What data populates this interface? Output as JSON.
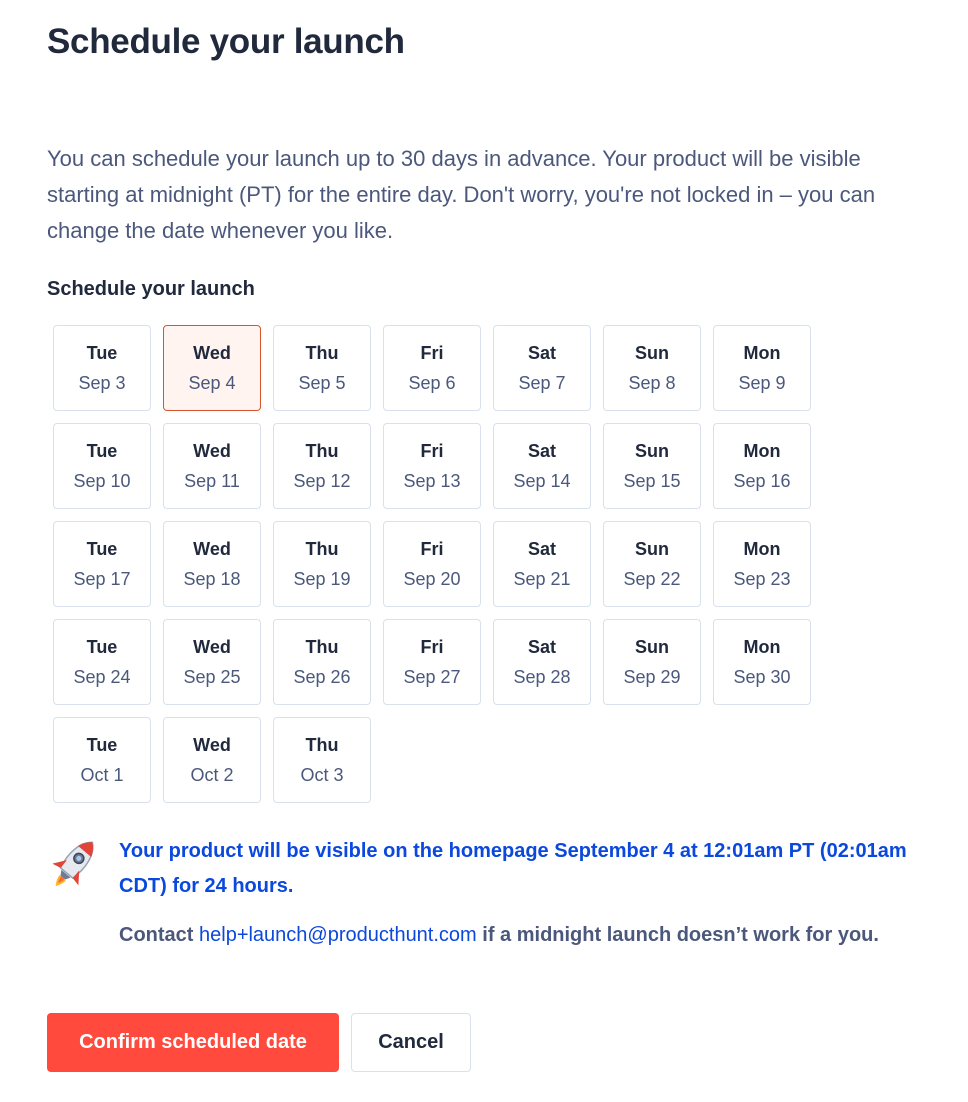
{
  "page": {
    "title": "Schedule your launch",
    "intro": "You can schedule your launch up to 30 days in advance. Your product will be visible starting at midnight (PT) for the entire day. Don't worry, you're not locked in – you can change the date whenever you like.",
    "section_label": "Schedule your launch"
  },
  "dates": [
    {
      "day": "Tue",
      "date": "Sep 3",
      "selected": false
    },
    {
      "day": "Wed",
      "date": "Sep 4",
      "selected": true
    },
    {
      "day": "Thu",
      "date": "Sep 5",
      "selected": false
    },
    {
      "day": "Fri",
      "date": "Sep 6",
      "selected": false
    },
    {
      "day": "Sat",
      "date": "Sep 7",
      "selected": false
    },
    {
      "day": "Sun",
      "date": "Sep 8",
      "selected": false
    },
    {
      "day": "Mon",
      "date": "Sep 9",
      "selected": false
    },
    {
      "day": "Tue",
      "date": "Sep 10",
      "selected": false
    },
    {
      "day": "Wed",
      "date": "Sep 11",
      "selected": false
    },
    {
      "day": "Thu",
      "date": "Sep 12",
      "selected": false
    },
    {
      "day": "Fri",
      "date": "Sep 13",
      "selected": false
    },
    {
      "day": "Sat",
      "date": "Sep 14",
      "selected": false
    },
    {
      "day": "Sun",
      "date": "Sep 15",
      "selected": false
    },
    {
      "day": "Mon",
      "date": "Sep 16",
      "selected": false
    },
    {
      "day": "Tue",
      "date": "Sep 17",
      "selected": false
    },
    {
      "day": "Wed",
      "date": "Sep 18",
      "selected": false
    },
    {
      "day": "Thu",
      "date": "Sep 19",
      "selected": false
    },
    {
      "day": "Fri",
      "date": "Sep 20",
      "selected": false
    },
    {
      "day": "Sat",
      "date": "Sep 21",
      "selected": false
    },
    {
      "day": "Sun",
      "date": "Sep 22",
      "selected": false
    },
    {
      "day": "Mon",
      "date": "Sep 23",
      "selected": false
    },
    {
      "day": "Tue",
      "date": "Sep 24",
      "selected": false
    },
    {
      "day": "Wed",
      "date": "Sep 25",
      "selected": false
    },
    {
      "day": "Thu",
      "date": "Sep 26",
      "selected": false
    },
    {
      "day": "Fri",
      "date": "Sep 27",
      "selected": false
    },
    {
      "day": "Sat",
      "date": "Sep 28",
      "selected": false
    },
    {
      "day": "Sun",
      "date": "Sep 29",
      "selected": false
    },
    {
      "day": "Mon",
      "date": "Sep 30",
      "selected": false
    },
    {
      "day": "Tue",
      "date": "Oct 1",
      "selected": false
    },
    {
      "day": "Wed",
      "date": "Oct 2",
      "selected": false
    },
    {
      "day": "Thu",
      "date": "Oct 3",
      "selected": false
    }
  ],
  "notice": {
    "icon": "rocket-icon",
    "visibility_text": "Your product will be visible on the homepage September 4 at 12:01am PT (02:01am CDT) for 24 hours.",
    "contact_prefix": "Contact ",
    "contact_email": "help+launch@producthunt.com",
    "contact_suffix": " if a midnight launch doesn’t work for you."
  },
  "buttons": {
    "confirm_label": "Confirm scheduled date",
    "cancel_label": "Cancel"
  },
  "colors": {
    "primary": "#ff4a3d",
    "selected_border": "#da552f",
    "selected_bg": "#fff4ef",
    "link": "#0b48dd",
    "heading": "#21293c",
    "body": "#4b587c"
  }
}
